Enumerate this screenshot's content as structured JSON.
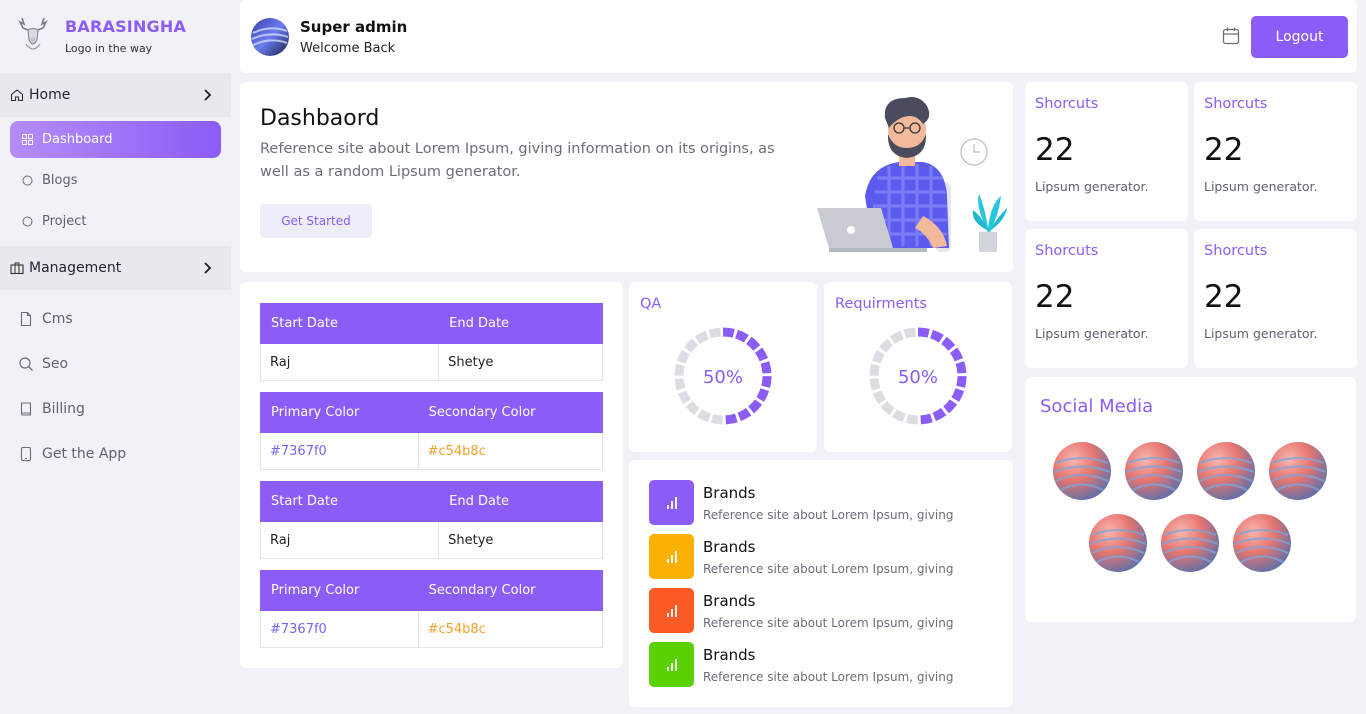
{
  "brand": {
    "name": "BARASINGHA",
    "tagline": "Logo in the way"
  },
  "sidebar": {
    "home": {
      "label": "Home",
      "icon": "home-icon"
    },
    "home_items": [
      {
        "label": "Dashboard",
        "icon": "grid-icon",
        "active": true
      },
      {
        "label": "Blogs",
        "icon": "circle-icon"
      },
      {
        "label": "Project",
        "icon": "circle-icon"
      }
    ],
    "management": {
      "label": "Management",
      "icon": "briefcase-icon"
    },
    "management_items": [
      {
        "label": "Cms",
        "icon": "file-icon"
      },
      {
        "label": "Seo",
        "icon": "search-icon"
      },
      {
        "label": "Billing",
        "icon": "book-icon"
      },
      {
        "label": "Get the App",
        "icon": "phone-icon"
      }
    ]
  },
  "topbar": {
    "user_name": "Super admin",
    "user_sub": "Welcome Back",
    "logout_label": "Logout"
  },
  "hero": {
    "title": "Dashbaord",
    "text": "Reference site about Lorem Ipsum, giving information on its origins, as well as a random Lipsum generator.",
    "button_label": "Get Started"
  },
  "tables": [
    {
      "headers": [
        "Start Date",
        "End Date"
      ],
      "row": [
        "Raj",
        "Shetye"
      ]
    },
    {
      "headers": [
        "Primary Color",
        "Secondary Color"
      ],
      "row": [
        "#7367f0",
        "#c54b8c"
      ]
    },
    {
      "headers": [
        "Start Date",
        "End Date"
      ],
      "row": [
        "Raj",
        "Shetye"
      ]
    },
    {
      "headers": [
        "Primary Color",
        "Secondary Color"
      ],
      "row": [
        "#7367f0",
        "#c54b8c"
      ]
    }
  ],
  "gauges": [
    {
      "title": "QA",
      "value_label": "50%",
      "value": 0.5
    },
    {
      "title": "Requirments",
      "value_label": "50%",
      "value": 0.5
    }
  ],
  "brands": [
    {
      "name": "Brands",
      "desc": "Reference site about Lorem Ipsum, giving",
      "color": "#8b5cf6"
    },
    {
      "name": "Brands",
      "desc": "Reference site about Lorem Ipsum, giving",
      "color": "#fbb104"
    },
    {
      "name": "Brands",
      "desc": "Reference site about Lorem Ipsum, giving",
      "color": "#fb5a24"
    },
    {
      "name": "Brands",
      "desc": "Reference site about Lorem Ipsum, giving",
      "color": "#5ad105"
    }
  ],
  "shortcuts": [
    {
      "title": "Shorcuts",
      "value": "22",
      "sub": "Lipsum generator."
    },
    {
      "title": "Shorcuts",
      "value": "22",
      "sub": "Lipsum generator."
    },
    {
      "title": "Shorcuts",
      "value": "22",
      "sub": "Lipsum generator."
    },
    {
      "title": "Shorcuts",
      "value": "22",
      "sub": "Lipsum generator."
    }
  ],
  "social": {
    "title": "Social Media",
    "count": 7
  },
  "colors": {
    "accent": "#8b5cf6",
    "primary": "#7367f0",
    "secondary_text": "#f0a02a",
    "background": "#f1f2f7"
  }
}
